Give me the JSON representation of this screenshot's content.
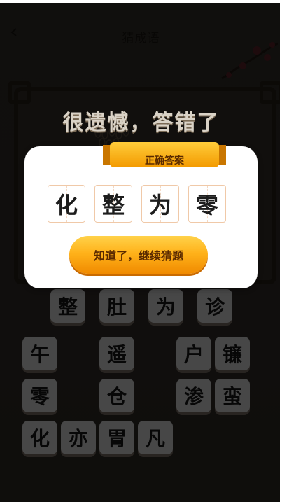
{
  "header": {
    "title": "猜成语"
  },
  "result": {
    "headline": "很遗憾，答错了"
  },
  "modal": {
    "ribbon_label": "正确答案",
    "answer": [
      "化",
      "整",
      "为",
      "零"
    ],
    "continue_label": "知道了，继续猜题"
  },
  "tiles": {
    "row1": [
      "整",
      "肚",
      "为",
      "诊"
    ],
    "row2": [
      "午",
      "遥",
      "户",
      "镰"
    ],
    "row3": [
      "零",
      "仓",
      "渗",
      "蛮"
    ],
    "row4": [
      "化",
      "亦",
      "胃",
      "凡"
    ]
  },
  "colors": {
    "accent": "#ffb21a",
    "ribbon": "#f5a300",
    "overlay": "#000000"
  }
}
